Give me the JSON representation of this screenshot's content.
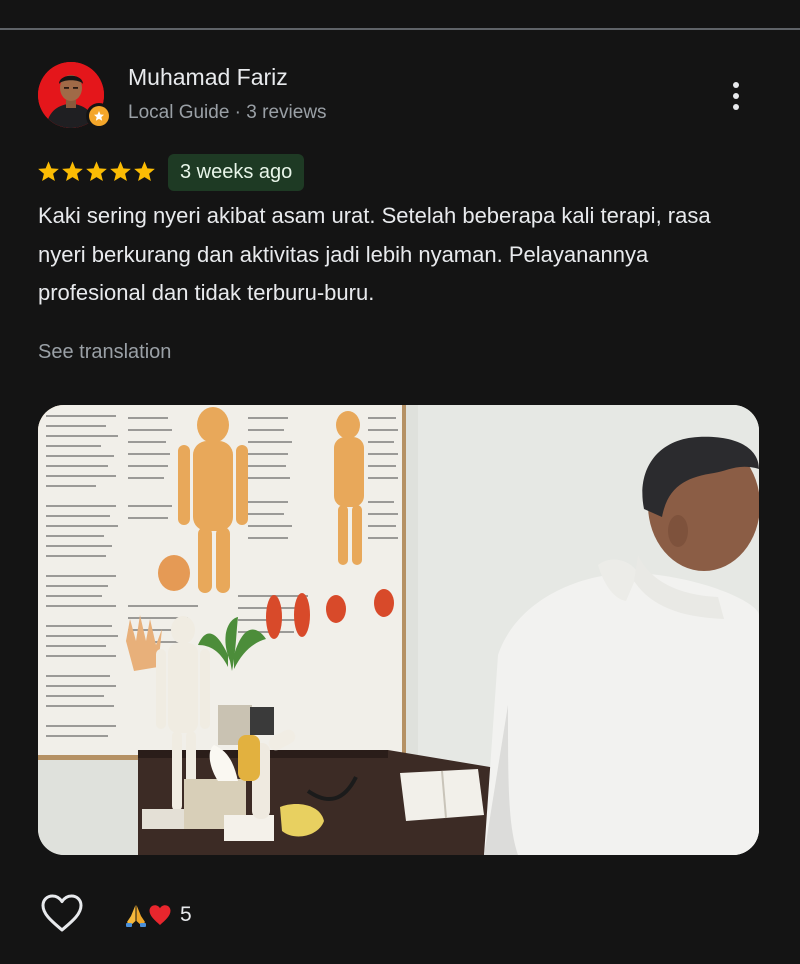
{
  "reviewer": {
    "name": "Muhamad Fariz",
    "role": "Local Guide",
    "separator": "·",
    "reviews": "3 reviews",
    "subtitle": "Local Guide · 3 reviews"
  },
  "review": {
    "rating": 5,
    "max_rating": 5,
    "time_ago": "3 weeks ago",
    "text": "Kaki sering nyeri akibat asam urat. Setelah beberapa kali terapi, rasa nyeri berkurang dan aktivitas jadi lebih nyaman. Pelayanannya profesional dan tidak terburu-buru.",
    "see_translation": "See translation"
  },
  "reactions": {
    "emojis": [
      "folded-hands-emoji",
      "red-heart-emoji"
    ],
    "count": "5"
  },
  "icons": {
    "menu": "more-vert-icon",
    "like": "heart-outline-icon",
    "star": "star-icon",
    "badge": "local-guide-badge-icon"
  },
  "colors": {
    "background": "#141414",
    "star": "#fbbc04",
    "time_badge_bg": "#1e3a24",
    "avatar_bg": "#e4161b",
    "muted_text": "#9aa0a6"
  }
}
